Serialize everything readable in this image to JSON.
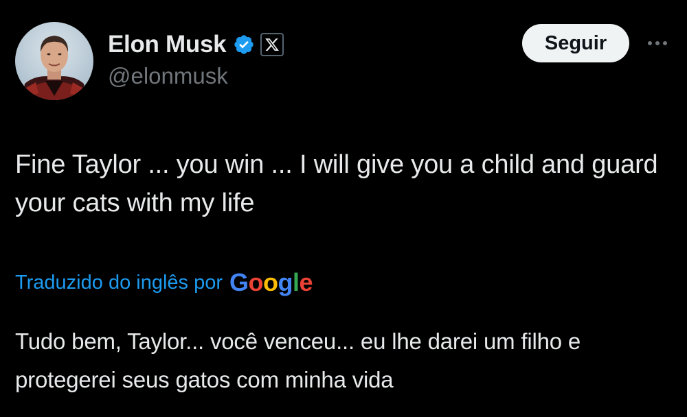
{
  "author": {
    "display_name": "Elon Musk",
    "handle": "@elonmusk",
    "verified_icon": "verified-badge-icon",
    "affiliate_icon": "x-logo-icon"
  },
  "actions": {
    "follow_label": "Seguir",
    "more_icon": "more-dots-icon"
  },
  "tweet": {
    "text": "Fine Taylor ... you win ... I will give you a child and guard your cats with my life"
  },
  "translation": {
    "label": "Traduzido do inglês por",
    "provider_letters": [
      "G",
      "o",
      "o",
      "g",
      "l",
      "e"
    ],
    "text": "Tudo bem, Taylor... você venceu... eu lhe darei um filho e protegerei seus gatos com minha vida"
  },
  "colors": {
    "background": "#000000",
    "text_primary": "#e7e9ea",
    "text_secondary": "#71767b",
    "accent_blue": "#1d9bf0",
    "follow_button_bg": "#eff3f4",
    "google_blue": "#4285F4",
    "google_red": "#EA4335",
    "google_yellow": "#FBBC05",
    "google_green": "#34A853"
  }
}
